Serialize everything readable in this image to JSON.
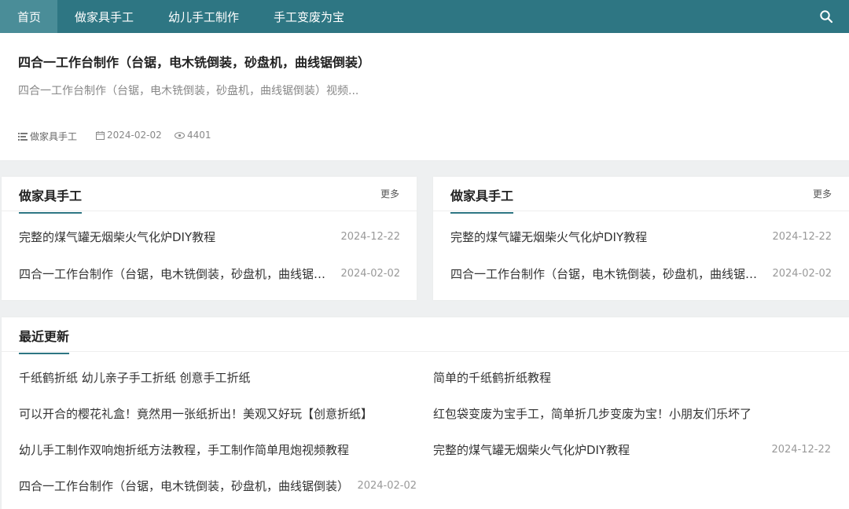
{
  "nav": {
    "items": [
      "首页",
      "做家具手工",
      "幼儿手工制作",
      "手工变废为宝"
    ],
    "search_icon": "search-icon"
  },
  "featured": {
    "title": "四合一工作台制作（台锯，电木铣倒装，砂盘机，曲线锯倒装）",
    "excerpt": "四合一工作台制作（台锯，电木铣倒装，砂盘机，曲线锯倒装）视频...",
    "category": "做家具手工",
    "date": "2024-02-02",
    "views": "4401"
  },
  "section_left": {
    "title": "做家具手工",
    "more": "更多",
    "items": [
      {
        "title": "完整的煤气罐无烟柴火气化炉DIY教程",
        "date": "2024-12-22"
      },
      {
        "title": "四合一工作台制作（台锯，电木铣倒装，砂盘机，曲线锯倒装）",
        "date": "2024-02-02"
      }
    ]
  },
  "section_right": {
    "title": "做家具手工",
    "more": "更多",
    "items": [
      {
        "title": "完整的煤气罐无烟柴火气化炉DIY教程",
        "date": "2024-12-22"
      },
      {
        "title": "四合一工作台制作（台锯，电木铣倒装，砂盘机，曲线锯倒装）",
        "date": "2024-02-02"
      }
    ]
  },
  "recent": {
    "title": "最近更新",
    "left_items": [
      {
        "title": "千纸鹤折纸 幼儿亲子手工折纸 创意手工折纸",
        "date": ""
      },
      {
        "title": "可以开合的樱花礼盒！竟然用一张纸折出！美观又好玩【创意折纸】",
        "date": ""
      },
      {
        "title": "幼儿手工制作双响炮折纸方法教程，手工制作简单甩炮视频教程",
        "date": ""
      },
      {
        "title": "四合一工作台制作（台锯，电木铣倒装，砂盘机，曲线锯倒装）",
        "date": "2024-02-02"
      }
    ],
    "right_items": [
      {
        "title": "简单的千纸鹤折纸教程",
        "date": ""
      },
      {
        "title": "红包袋变废为宝手工，简单折几步变废为宝！小朋友们乐坏了",
        "date": ""
      },
      {
        "title": "完整的煤气罐无烟柴火气化炉DIY教程",
        "date": "2024-12-22"
      }
    ]
  },
  "colors": {
    "nav_bg": "#2e7683",
    "nav_active": "#4a8d98",
    "accent": "#2e7683"
  }
}
